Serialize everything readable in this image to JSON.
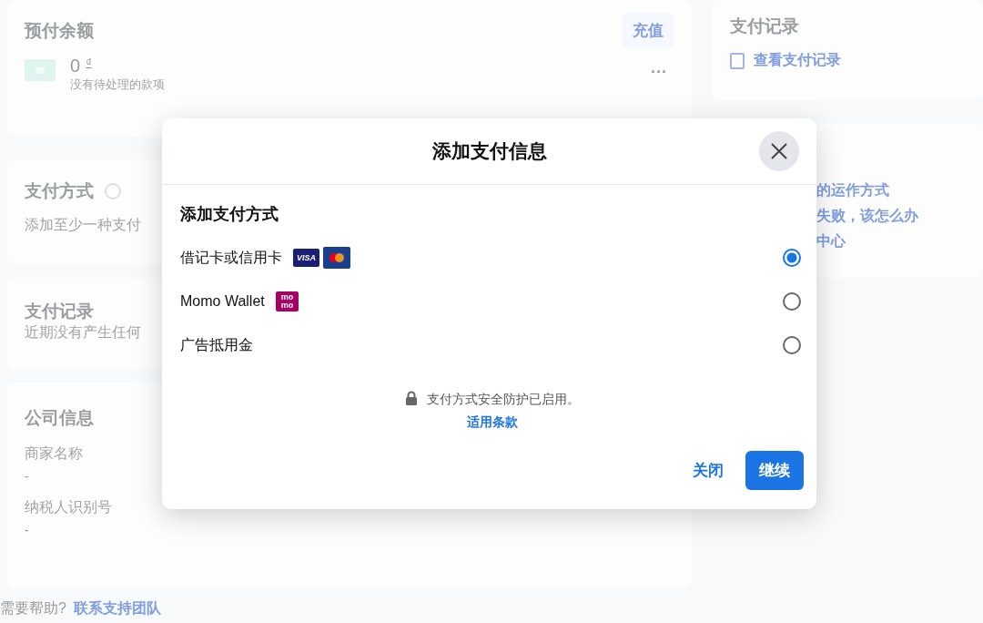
{
  "background": {
    "prepaid": {
      "title": "预付余额",
      "button": "充值",
      "amount": "0",
      "currency": "₫",
      "note": "没有待处理的款项",
      "more": "···"
    },
    "payment_methods": {
      "title": "支付方式",
      "description": "添加至少一种支付"
    },
    "payment_history": {
      "title": "支付记录",
      "description": "近期没有产生任何"
    },
    "company_info": {
      "title": "公司信息",
      "fields": [
        {
          "label": "商家名称",
          "value": "-"
        },
        {
          "label": "纳税人识别号",
          "value": "-"
        }
      ]
    },
    "help": {
      "text": "需要帮助?",
      "link": "联系支持团队"
    },
    "sidebar": {
      "title": "支付记录",
      "link": "查看支付记录",
      "links": [
        "的运作方式",
        "失败，该怎么办",
        "中心"
      ]
    }
  },
  "dialog": {
    "title": "添加支付信息",
    "section": "添加支付方式",
    "options": [
      {
        "label": "借记卡或信用卡",
        "kind": "card",
        "badge": "VISA",
        "selected": true
      },
      {
        "label": "Momo Wallet",
        "kind": "momo",
        "badge_lines": [
          "mo",
          "mo"
        ],
        "selected": false
      },
      {
        "label": "广告抵用金",
        "kind": "plain",
        "selected": false
      }
    ],
    "security": "支付方式安全防护已启用。",
    "terms": "适用条款",
    "close": "关闭",
    "continue": "继续"
  }
}
